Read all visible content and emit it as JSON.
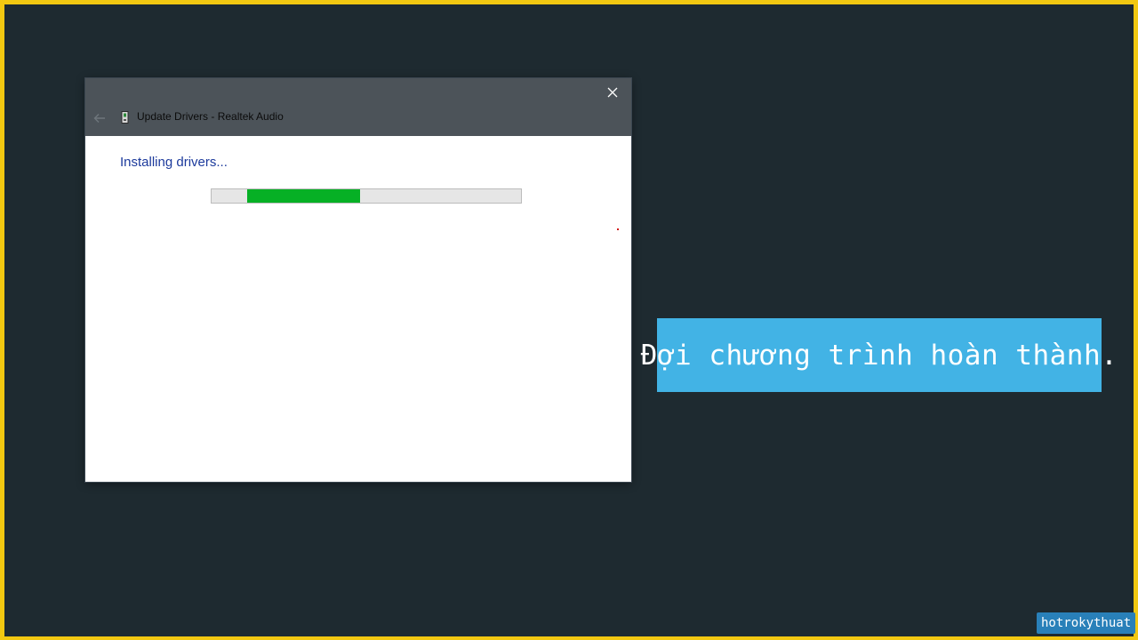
{
  "dialog": {
    "title": "Update Drivers - Realtek Audio",
    "status": "Installing drivers...",
    "progress_state": "indeterminate",
    "progress_fill_color": "#06b025",
    "titlebar_color": "#4c5359",
    "icons": {
      "close": "close-icon",
      "back": "back-arrow-icon",
      "device": "device-manager-icon"
    }
  },
  "caption": {
    "text": "Đợi chương trình hoàn thành.",
    "background": "#42b3e5"
  },
  "watermark": {
    "text": "hotrokythuat"
  },
  "colors": {
    "frame_border": "#f2c811",
    "background": "#1e2a30"
  }
}
